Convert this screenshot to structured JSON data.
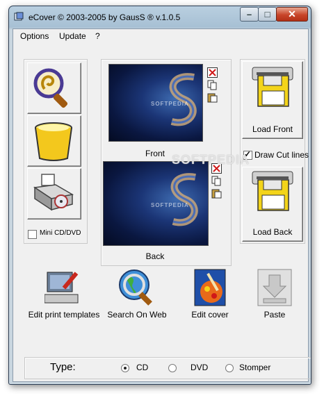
{
  "window": {
    "title": "eCover © 2003-2005  by GausS ® v.1.0.5"
  },
  "menu": [
    "Options",
    "Update",
    "?"
  ],
  "covers": {
    "front_label": "Front",
    "back_label": "Back",
    "cover_text": "SOFTPEDIA"
  },
  "right_panel": {
    "load_front": "Load Front",
    "draw_cut_lines": "Draw Cut lines",
    "load_back": "Load Back"
  },
  "left_panel": {
    "mini_cd": "Mini CD/DVD"
  },
  "toolbar": {
    "edit_templates": "Edit print templates",
    "search_web": "Search On Web",
    "edit_cover": "Edit cover",
    "paste": "Paste"
  },
  "type": {
    "label": "Type:",
    "options": [
      "CD",
      "DVD",
      "Stomper"
    ],
    "selected": "CD"
  },
  "watermark": "SOFTPEDIA",
  "colors": {
    "accent_blue": "#1b3576",
    "close_red": "#c8452a"
  }
}
